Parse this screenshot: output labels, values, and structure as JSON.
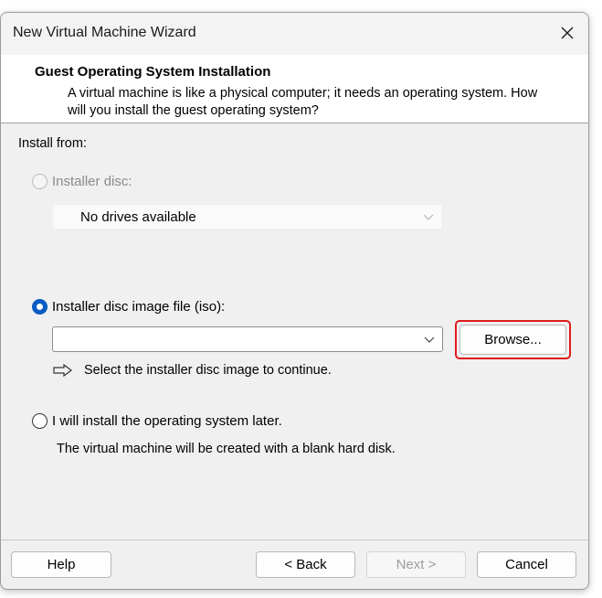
{
  "window": {
    "title": "New Virtual Machine Wizard",
    "close_icon": "close-icon"
  },
  "header": {
    "title": "Guest Operating System Installation",
    "description": "A virtual machine is like a physical computer; it needs an operating system. How will you install the guest operating system?"
  },
  "install_from": {
    "label": "Install from:",
    "options": [
      {
        "label": "Installer disc:",
        "selected": false,
        "enabled": false,
        "drive_value": "No drives available"
      },
      {
        "label": "Installer disc image file (iso):",
        "selected": true,
        "enabled": true,
        "iso_path": "",
        "browse_label": "Browse...",
        "hint": "Select the installer disc image to continue.",
        "hint_icon": "arrow-right-icon"
      },
      {
        "label": "I will install the operating system later.",
        "selected": false,
        "enabled": true,
        "note": "The virtual machine will be created with a blank hard disk."
      }
    ]
  },
  "footer": {
    "help_label": "Help",
    "back_label": "< Back",
    "next_label": "Next >",
    "cancel_label": "Cancel",
    "next_enabled": false
  },
  "colors": {
    "accent": "#0a5cc4",
    "highlight": "#e01b1b"
  }
}
